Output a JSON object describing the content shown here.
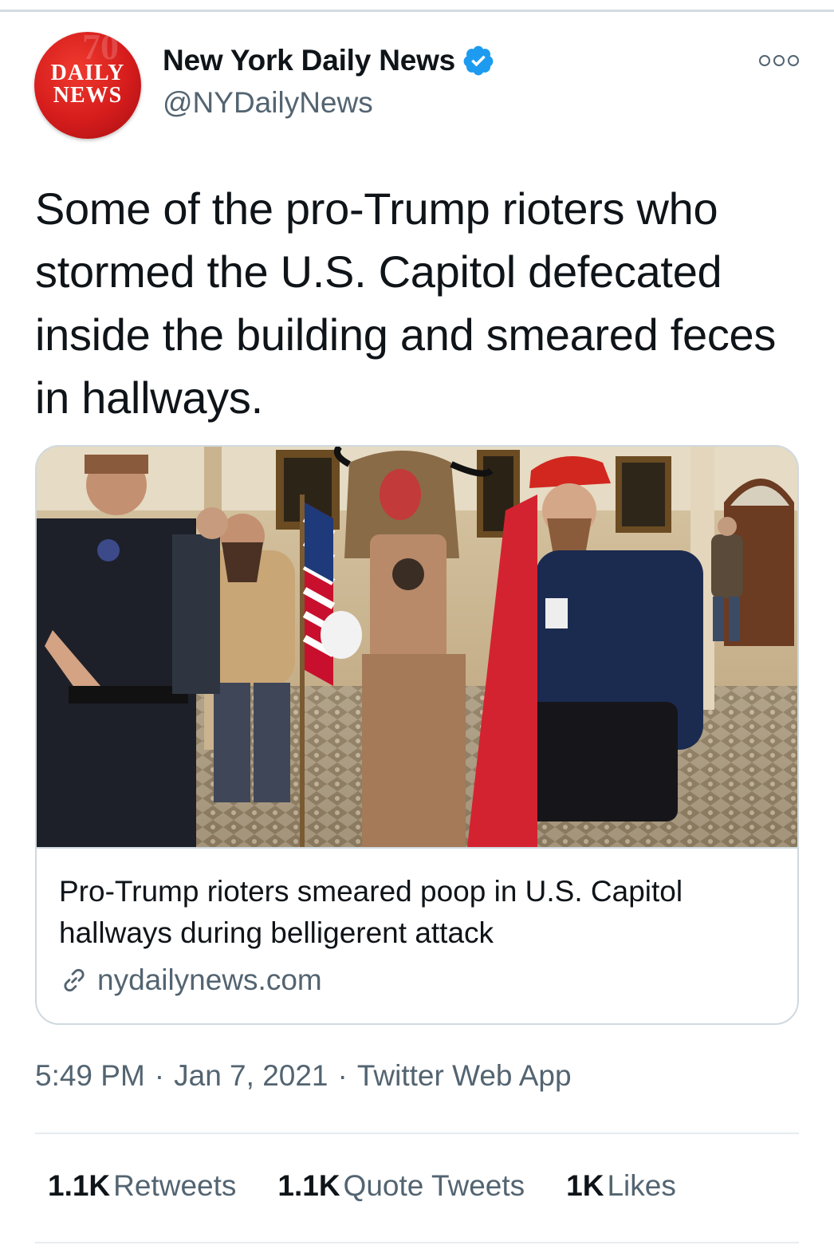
{
  "account": {
    "avatar_line1": "DAILY",
    "avatar_line2": "NEWS",
    "display_name": "New York Daily News",
    "handle": "@NYDailyNews",
    "verified": true,
    "verified_color": "#1d9bf0"
  },
  "tweet": {
    "text": "Some of the pro-Trump rioters who stormed the U.S. Capitol defecated inside the building and smeared feces in hallways."
  },
  "card": {
    "image_icon": "capitol-rioters-photo",
    "title": "Pro-Trump rioters smeared poop in U.S. Capitol hallways during belligerent attack",
    "domain": "nydailynews.com",
    "domain_icon": "link-icon"
  },
  "meta": {
    "time": "5:49 PM",
    "date": "Jan 7, 2021",
    "source": "Twitter Web App",
    "separator": "·"
  },
  "stats": [
    {
      "count": "1.1K",
      "label": "Retweets"
    },
    {
      "count": "1.1K",
      "label": "Quote Tweets"
    },
    {
      "count": "1K",
      "label": "Likes"
    }
  ],
  "colors": {
    "text_primary": "#0f1419",
    "text_secondary": "#536471",
    "border": "#cfd9de",
    "avatar_red": "#d51c1c"
  }
}
